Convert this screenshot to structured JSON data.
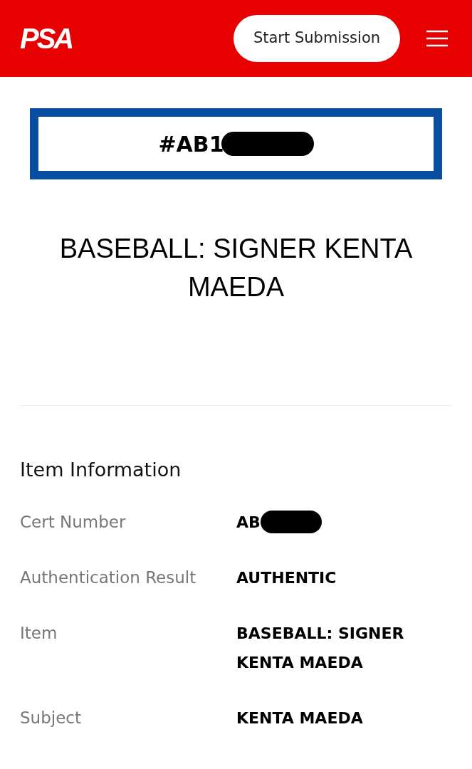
{
  "header": {
    "logo": "PSA",
    "button": "Start Submission"
  },
  "cert_banner": {
    "number": "#AB1",
    "redacted": true
  },
  "title": "BASEBALL: SIGNER KENTA MAEDA",
  "section": {
    "heading": "Item Information",
    "rows": [
      {
        "label": "Cert Number",
        "value": "AB",
        "redacted": true
      },
      {
        "label": "Authentication Result",
        "value": "AUTHENTIC",
        "redacted": false
      },
      {
        "label": "Item",
        "value": "BASEBALL: SIGNER KENTA MAEDA",
        "redacted": false
      },
      {
        "label": "Subject",
        "value": "KENTA MAEDA",
        "redacted": false
      }
    ]
  }
}
